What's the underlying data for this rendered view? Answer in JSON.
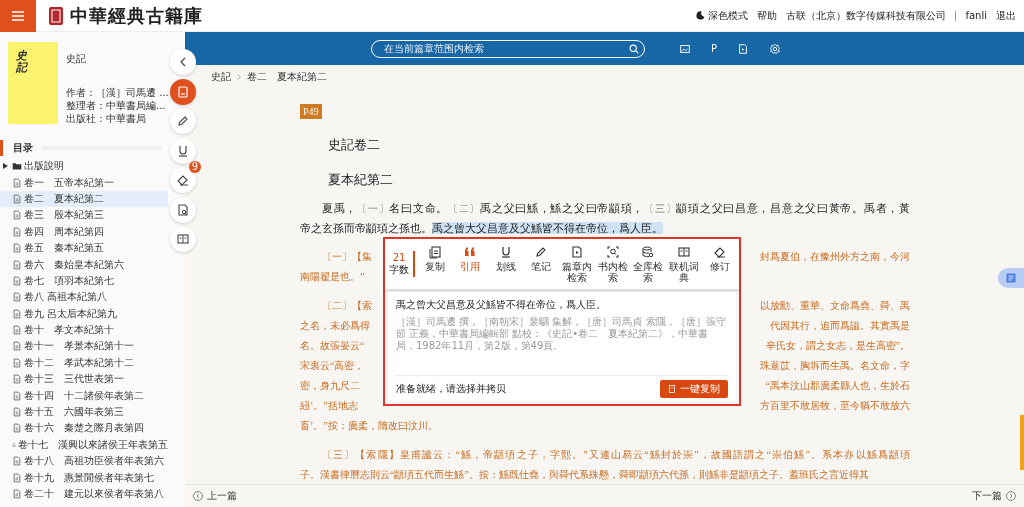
{
  "header": {
    "title": "中華經典古籍庫",
    "links": [
      {
        "kind": "theme",
        "label": "深色模式"
      },
      {
        "kind": "link",
        "label": "帮助"
      },
      {
        "kind": "link",
        "label": "古联（北京）数字传媒科技有限公司"
      },
      {
        "kind": "user",
        "label": "fanli"
      },
      {
        "kind": "link",
        "label": "退出"
      }
    ]
  },
  "book": {
    "cover_text": "史記",
    "title": "史記",
    "meta": [
      "作者：［漢］司馬遷 ...",
      "整理者：中華書局編...",
      "出版社：中華書局"
    ]
  },
  "toc": {
    "heading": "目录",
    "items": [
      {
        "label": "出版說明",
        "kind": "folder",
        "selected": false
      },
      {
        "label": "卷一　五帝本紀第一",
        "kind": "chapter",
        "selected": false
      },
      {
        "label": "卷二　夏本紀第二",
        "kind": "chapter",
        "selected": true
      },
      {
        "label": "卷三　殷本紀第三",
        "kind": "chapter",
        "selected": false
      },
      {
        "label": "卷四　周本紀第四",
        "kind": "chapter",
        "selected": false
      },
      {
        "label": "卷五　秦本紀第五",
        "kind": "chapter",
        "selected": false
      },
      {
        "label": "卷六　秦始皇本紀第六",
        "kind": "chapter",
        "selected": false
      },
      {
        "label": "卷七　項羽本紀第七",
        "kind": "chapter",
        "selected": false
      },
      {
        "label": "卷八 高祖本紀第八",
        "kind": "chapter",
        "selected": false
      },
      {
        "label": "卷九 呂太后本紀第九",
        "kind": "chapter",
        "selected": false
      },
      {
        "label": "卷十　孝文本紀第十",
        "kind": "chapter",
        "selected": false
      },
      {
        "label": "卷十一　孝景本紀第十一",
        "kind": "chapter",
        "selected": false
      },
      {
        "label": "卷十二　孝武本紀第十二",
        "kind": "chapter",
        "selected": false
      },
      {
        "label": "卷十三　三代世表第一",
        "kind": "chapter",
        "selected": false
      },
      {
        "label": "卷十四　十二諸侯年表第二",
        "kind": "chapter",
        "selected": false
      },
      {
        "label": "卷十五　六國年表第三",
        "kind": "chapter",
        "selected": false
      },
      {
        "label": "卷十六　秦楚之際月表第四",
        "kind": "chapter",
        "selected": false
      },
      {
        "label": "卷十七　漢興以來諸侯王年表第五",
        "kind": "chapter",
        "selected": false
      },
      {
        "label": "卷十八　高祖功臣侯者年表第六",
        "kind": "chapter",
        "selected": false
      },
      {
        "label": "卷十九　惠景閒侯者年表第七",
        "kind": "chapter",
        "selected": false
      },
      {
        "label": "卷二十　建元以來侯者年表第八",
        "kind": "chapter",
        "selected": false
      }
    ]
  },
  "rail": [
    {
      "kind": "back",
      "selected": false
    },
    {
      "kind": "save",
      "selected": true
    },
    {
      "kind": "pen",
      "selected": false
    },
    {
      "kind": "underline",
      "selected": false
    },
    {
      "kind": "eraser",
      "selected": false,
      "badge": "9"
    },
    {
      "kind": "doc-search",
      "selected": false
    },
    {
      "kind": "book",
      "selected": false
    }
  ],
  "topbar": {
    "search_placeholder": "在当前篇章范围内检索",
    "tools": [
      {
        "kind": "image"
      },
      {
        "kind": "text",
        "label": "P"
      },
      {
        "kind": "doc"
      },
      {
        "kind": "settings"
      }
    ]
  },
  "breadcrumb": [
    "史記",
    "卷二　夏本紀第二"
  ],
  "page_badge": "P49",
  "headings": [
    "史記卷二",
    "夏本紀第二"
  ],
  "paragraphs": [
    {
      "kind": "main",
      "lines": [
        [
          {
            "kind": "text",
            "text": "夏禹，"
          },
          {
            "kind": "note",
            "text": "〔一〕"
          },
          {
            "kind": "text",
            "text": "名曰文命。"
          },
          {
            "kind": "note",
            "text": "〔二〕"
          },
          {
            "kind": "text",
            "text": "禹之父曰鯀，鯀之父曰帝顓頊，"
          },
          {
            "kind": "note",
            "text": "〔三〕"
          },
          {
            "kind": "text",
            "text": "顓頊之父曰昌意，昌意之父曰黃帝。禹者，黃"
          }
        ],
        [
          {
            "kind": "text",
            "text": "帝之玄孫而帝顓頊之孫也。"
          },
          {
            "kind": "highlight",
            "text": "禹之曾大父昌意及父鯀皆不得在帝位，爲人臣。"
          }
        ]
      ]
    },
    {
      "kind": "commentary",
      "lines": [
        {
          "left": "〔一〕【集",
          "right": "封爲夏伯，在豫州外方之南，今河"
        },
        {
          "left": "南陽翟是也。”"
        }
      ]
    },
    {
      "kind": "commentary",
      "lines": [
        {
          "left": "〔二〕【索",
          "right": "以放勳、重華、文命爲堯、舜、禹"
        },
        {
          "left": "之名，未必爲得",
          "right": "代因其行，追而爲謚。其實禹是"
        },
        {
          "left": "名。故張晏云“",
          "right": "辛氏女，謂之女志，是生高密”。"
        },
        {
          "left": "宋衷云“高密，",
          "right": "珠薏苡，胸坼而生禹。名文命，字"
        },
        {
          "left": "密，身九尺二",
          "right": "“禹本汶山郡廣柔縣人也，生於石"
        },
        {
          "left": "紐’。”括地志",
          "right": "方百里不敢居牧，至今猶不敢放六"
        },
        {
          "left": "畜’。”按：廣柔，隋改曰汶川。"
        }
      ]
    },
    {
      "kind": "commentary",
      "lines": [
        {
          "left": "〔三〕【索隱】皇甫謐云：“鯀，帝顓頊之子，字熙。”又連山易云“鯀封於崇”，故國語謂之“崇伯鯀”。系本亦以鯀爲顓頊"
        },
        {
          "left": "子。漢書律曆志則云“顓頊五代而生鯀”。按：鯀既仕堯，與舜代系殊懸，舜即顓頊六代孫，則鯀非是顓頊之子。蓋班氏之言近得其"
        }
      ]
    }
  ],
  "popup": {
    "count": "21",
    "count_label": "字数",
    "tools": [
      {
        "kind": "copy",
        "label": "复制",
        "selected": false
      },
      {
        "kind": "quote",
        "label": "引用",
        "selected": true
      },
      {
        "kind": "underline",
        "label": "划线",
        "selected": false
      },
      {
        "kind": "pen",
        "label": "笔记",
        "selected": false
      },
      {
        "kind": "doc",
        "label": "篇章内检索",
        "selected": false
      },
      {
        "kind": "scan",
        "label": "书内检索",
        "selected": false
      },
      {
        "kind": "db",
        "label": "全库检索",
        "selected": false
      },
      {
        "kind": "book",
        "label": "联机词典",
        "selected": false
      },
      {
        "kind": "eraser",
        "label": "修订",
        "selected": false
      }
    ],
    "quote": "禹之曾大父昌意及父鯀皆不得在帝位，爲人臣。",
    "citation": "［漢］司馬遷 撰，［南朝宋］裴駰 集解，［唐］司馬貞 索隱，［唐］張守節 正義，中華書局編輯部 點校：《史記•卷二　夏本紀第二》，中華書局，1982年11月，第2版，第49頁。",
    "status": "准备就绪，请选择并拷贝",
    "button": "一键复制"
  },
  "footer": {
    "prev": "上一篇",
    "next": "下一篇"
  }
}
